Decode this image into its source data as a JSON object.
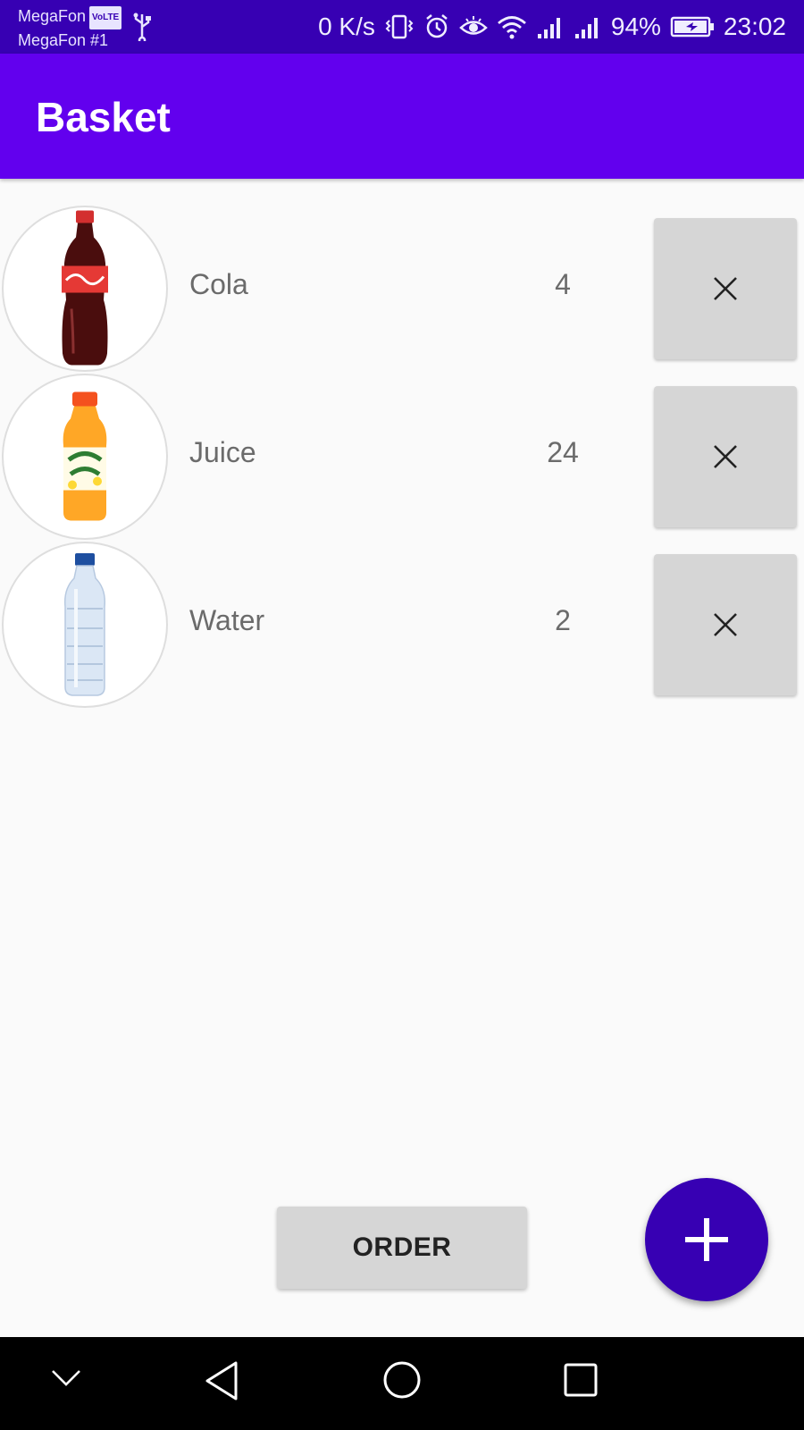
{
  "status_bar": {
    "carrier_1": "MegaFon",
    "volte_badge": "VoLTE",
    "carrier_2": "MegaFon #1",
    "net_speed": "0 K/s",
    "battery": "94%",
    "time": "23:02",
    "icons": [
      "usb-icon",
      "vibrate-icon",
      "alarm-icon",
      "eye-icon",
      "wifi-icon",
      "signal-icon",
      "signal-icon",
      "battery-charging-icon"
    ]
  },
  "app_bar": {
    "title": "Basket"
  },
  "basket": {
    "items": [
      {
        "name": "Cola",
        "quantity": "4",
        "image": "cola-bottle",
        "remove_icon": "close-icon"
      },
      {
        "name": "Juice",
        "quantity": "24",
        "image": "juice-bottle",
        "remove_icon": "close-icon"
      },
      {
        "name": "Water",
        "quantity": "2",
        "image": "water-bottle",
        "remove_icon": "close-icon"
      }
    ]
  },
  "actions": {
    "order_label": "ORDER",
    "fab_icon": "plus-icon"
  },
  "nav_bar": {
    "icons": [
      "chevron-down-icon",
      "back-icon",
      "home-icon",
      "recents-icon"
    ]
  },
  "colors": {
    "status_bar": "#3700b3",
    "app_bar": "#6200ee",
    "fab": "#3700b3",
    "button_gray": "#d6d6d6",
    "background": "#fafafa"
  }
}
